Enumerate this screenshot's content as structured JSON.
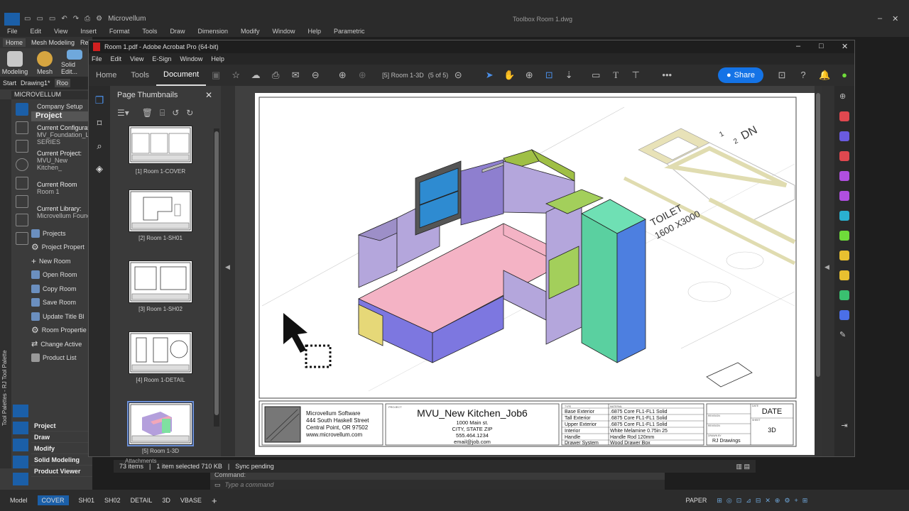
{
  "acad": {
    "window_title": "Toolbox  Room 1.dwg",
    "workspace": "Microvellum",
    "menu": [
      "File",
      "Edit",
      "View",
      "Insert",
      "Format",
      "Tools",
      "Draw",
      "Dimension",
      "Modify",
      "Window",
      "Help",
      "Parametric"
    ],
    "ribbon_tabs": [
      "Home",
      "Mesh Modeling",
      "Re"
    ],
    "ribbon_buttons": [
      "Modeling",
      "Mesh",
      "Solid Edit..."
    ],
    "doc_tabs": [
      "Start",
      "Drawing1*",
      "Roo"
    ],
    "palette_header": "MICROVELLUM",
    "palette_side_label": "Tool Palettes - RJ Tool Palette",
    "company_setup": "Company Setup",
    "project_heading": "Project",
    "current_config_label": "Current Configurat",
    "current_config_value": "MV_Foundation_Li",
    "current_config_series": "SERIES",
    "current_project_label": "Current Project:",
    "current_project_value": "MVU_New Kitchen_",
    "current_room_label": "Current Room",
    "current_room_value": "Room 1",
    "current_library_label": "Current Library:",
    "current_library_value": "Microvellum Found",
    "project_items": [
      "Projects",
      "Project Propert",
      "New Room",
      "Open Room",
      "Copy Room",
      "Save Room",
      "Update Title Bl",
      "Room Propertie",
      "Change Active",
      "Product List"
    ],
    "bottom_categories": [
      "Project",
      "Draw",
      "Modify",
      "Solid Modeling",
      "Product Viewer"
    ],
    "command_label": "Command:",
    "command_placeholder": "Type a command",
    "layout_tabs": [
      "Model",
      "COVER",
      "SH01",
      "SH02",
      "DETAIL",
      "3D",
      "VBASE"
    ],
    "paper_label": "PAPER",
    "add_tab": "+"
  },
  "acrobat": {
    "title": "Room 1.pdf - Adobe Acrobat Pro (64-bit)",
    "menu": [
      "File",
      "Edit",
      "View",
      "E-Sign",
      "Window",
      "Help"
    ],
    "tabs": [
      "Home",
      "Tools",
      "Document"
    ],
    "active_tab": "Document",
    "page_indicator": "[5] Room 1-3D",
    "page_count": "(5 of 5)",
    "share_label": "Share",
    "thumbnails_title": "Page Thumbnails",
    "thumbnails": [
      {
        "label": "[1] Room 1-COVER"
      },
      {
        "label": "[2] Room 1-SH01"
      },
      {
        "label": "[3] Room 1-SH02"
      },
      {
        "label": "[4] Room 1-DETAIL"
      },
      {
        "label": "[5] Room 1-3D"
      }
    ]
  },
  "drawing": {
    "room_label_1": "TOILET",
    "room_label_2": "1600 X3000",
    "dn_label": "DN",
    "stair_1": "1",
    "stair_2": "2",
    "company_name": "Microvellum Software",
    "company_addr1": "444 South Haskell Street",
    "company_addr2": "Central Point, OR 97502",
    "company_web": "www.microvellum.com",
    "project_small": "PROJECT",
    "project_name": "MVU_New Kitchen_Job6",
    "project_addr1": "1000 Main st.",
    "project_addr2": "CITY, STATE ZIP",
    "project_phone": "555.464.1234",
    "project_email": "email@job.com",
    "spec_header": "TYPE",
    "spec_header2": "MATERIAL",
    "specs": [
      {
        "k": "Base Exterior",
        "v": ".6875 Core FL1-FL1 Solid"
      },
      {
        "k": "Tall Exterior",
        "v": ".6875 Core FL1-FL1 Solid"
      },
      {
        "k": "Upper Exterior",
        "v": ".6875 Core FL1-FL1 Solid"
      },
      {
        "k": "Interior",
        "v": "White Melamine 0.75in 25"
      },
      {
        "k": "Handle",
        "v": "Handle Rod 120mm"
      },
      {
        "k": "Drawer System",
        "v": "Wood Drawer Box"
      }
    ],
    "date_label": "DATE",
    "view_label": "3D",
    "drawn_by": "RJ Drawings",
    "small_date": "DATE",
    "small_revision": "REVISION",
    "small_drawn": "DRAWN BY",
    "small_sheet": "SHEET",
    "small_revision2": "REVISION"
  },
  "explorer_status": {
    "items": "73 items",
    "selected": "1 item selected  710 KB",
    "sync": "Sync pending",
    "attachments": "Attachments"
  }
}
